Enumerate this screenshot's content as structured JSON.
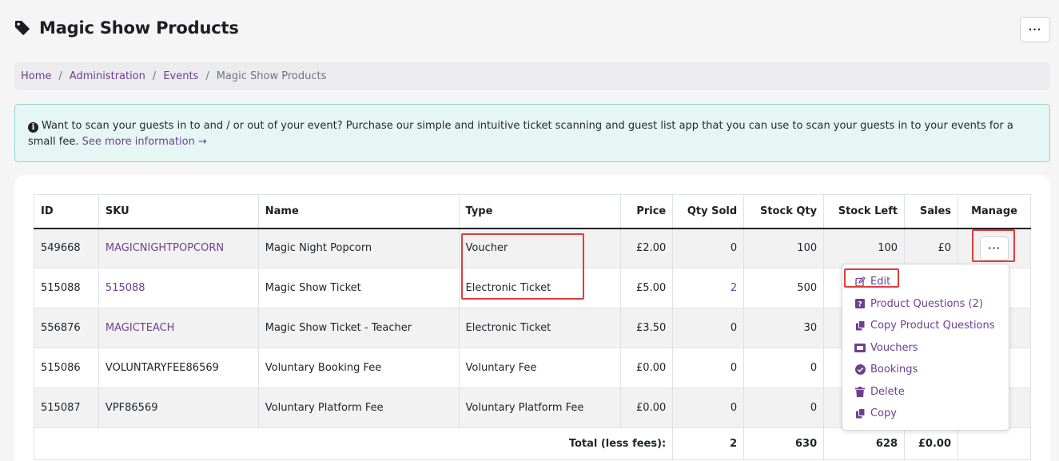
{
  "page": {
    "title": "Magic Show Products",
    "menu_button": "···"
  },
  "breadcrumb": {
    "items": [
      {
        "label": "Home"
      },
      {
        "label": "Administration"
      },
      {
        "label": "Events"
      }
    ],
    "separator": "/",
    "current": "Magic Show Products"
  },
  "alert": {
    "text": "Want to scan your guests in to and / or out of your event? Purchase our simple and intuitive ticket scanning and guest list app that you can use to scan your guests in to your events for a small fee.",
    "link": "See more information →"
  },
  "table": {
    "columns": [
      "ID",
      "SKU",
      "Name",
      "Type",
      "Price",
      "Qty Sold",
      "Stock Qty",
      "Stock Left",
      "Sales",
      "Manage"
    ],
    "rows": [
      {
        "id": "549668",
        "sku": "MAGICNIGHTPOPCORN",
        "sku_link": true,
        "name": "Magic Night Popcorn",
        "type": "Voucher",
        "price": "£2.00",
        "qty_sold": "0",
        "stock_qty": "100",
        "stock_left": "100",
        "sales": "£0",
        "manage": "···"
      },
      {
        "id": "515088",
        "sku": "515088",
        "sku_link": true,
        "name": "Magic Show Ticket",
        "type": "Electronic Ticket",
        "price": "£5.00",
        "qty_sold": "2",
        "stock_qty": "500",
        "stock_left": "",
        "sales": "",
        "manage": ""
      },
      {
        "id": "556876",
        "sku": "MAGICTEACH",
        "sku_link": true,
        "name": "Magic Show Ticket - Teacher",
        "type": "Electronic Ticket",
        "price": "£3.50",
        "qty_sold": "0",
        "stock_qty": "30",
        "stock_left": "",
        "sales": "",
        "manage": ""
      },
      {
        "id": "515086",
        "sku": "VOLUNTARYFEE86569",
        "sku_link": false,
        "name": "Voluntary Booking Fee",
        "type": "Voluntary Fee",
        "price": "£0.00",
        "qty_sold": "0",
        "stock_qty": "0",
        "stock_left": "",
        "sales": "",
        "manage": ""
      },
      {
        "id": "515087",
        "sku": "VPF86569",
        "sku_link": false,
        "name": "Voluntary Platform Fee",
        "type": "Voluntary Platform Fee",
        "price": "£0.00",
        "qty_sold": "0",
        "stock_qty": "0",
        "stock_left": "",
        "sales": "",
        "manage": ""
      }
    ],
    "total": {
      "label": "Total (less fees):",
      "qty_sold": "2",
      "stock_qty": "630",
      "stock_left": "628",
      "sales": "£0.00"
    }
  },
  "dropdown": {
    "items": [
      {
        "label": "Edit",
        "icon": "edit-icon"
      },
      {
        "label": "Product Questions (2)",
        "icon": "question-icon"
      },
      {
        "label": "Copy Product Questions",
        "icon": "copy-icon"
      },
      {
        "label": "Vouchers",
        "icon": "ticket-icon"
      },
      {
        "label": "Bookings",
        "icon": "check-circle-icon"
      },
      {
        "label": "Delete",
        "icon": "trash-icon"
      },
      {
        "label": "Copy",
        "icon": "copy-icon"
      }
    ]
  },
  "colors": {
    "accent": "#6f3f8f",
    "highlight": "#e03c3c",
    "alert_bg": "#e6f6f4",
    "alert_border": "#8dd4cb"
  }
}
